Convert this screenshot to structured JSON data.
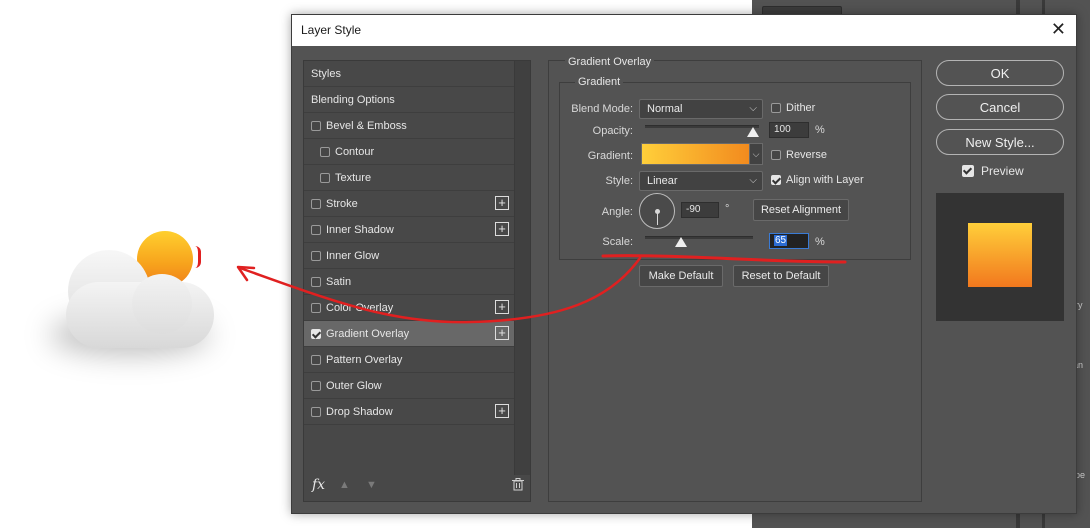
{
  "dialog": {
    "title": "Layer Style",
    "close_glyph": "✕"
  },
  "styles_list": {
    "items": [
      {
        "label": "Styles",
        "checkbox": false,
        "plus": false,
        "indent": false,
        "checked": false
      },
      {
        "label": "Blending Options",
        "checkbox": false,
        "plus": false,
        "indent": false,
        "checked": false
      },
      {
        "label": "Bevel & Emboss",
        "checkbox": true,
        "plus": false,
        "indent": false,
        "checked": false
      },
      {
        "label": "Contour",
        "checkbox": true,
        "plus": false,
        "indent": true,
        "checked": false
      },
      {
        "label": "Texture",
        "checkbox": true,
        "plus": false,
        "indent": true,
        "checked": false
      },
      {
        "label": "Stroke",
        "checkbox": true,
        "plus": true,
        "indent": false,
        "checked": false
      },
      {
        "label": "Inner Shadow",
        "checkbox": true,
        "plus": true,
        "indent": false,
        "checked": false
      },
      {
        "label": "Inner Glow",
        "checkbox": true,
        "plus": false,
        "indent": false,
        "checked": false
      },
      {
        "label": "Satin",
        "checkbox": true,
        "plus": false,
        "indent": false,
        "checked": false
      },
      {
        "label": "Color Overlay",
        "checkbox": true,
        "plus": true,
        "indent": false,
        "checked": false
      },
      {
        "label": "Gradient Overlay",
        "checkbox": true,
        "plus": true,
        "indent": false,
        "checked": true,
        "selected": true
      },
      {
        "label": "Pattern Overlay",
        "checkbox": true,
        "plus": false,
        "indent": false,
        "checked": false
      },
      {
        "label": "Outer Glow",
        "checkbox": true,
        "plus": false,
        "indent": false,
        "checked": false
      },
      {
        "label": "Drop Shadow",
        "checkbox": true,
        "plus": true,
        "indent": false,
        "checked": false
      }
    ],
    "footer": {
      "fx": "fx",
      "up": "▲",
      "down": "▼",
      "trash": "🗑"
    }
  },
  "gradient_overlay": {
    "group_title": "Gradient Overlay",
    "subgroup_title": "Gradient",
    "blend_mode": {
      "label": "Blend Mode:",
      "value": "Normal"
    },
    "dither": {
      "label": "Dither",
      "checked": false
    },
    "opacity": {
      "label": "Opacity:",
      "value": "100",
      "unit": "%",
      "fraction": 1.0
    },
    "gradient": {
      "label": "Gradient:",
      "colors": [
        "#ffcf3a",
        "#f28a1e"
      ]
    },
    "reverse": {
      "label": "Reverse",
      "checked": false
    },
    "style": {
      "label": "Style:",
      "value": "Linear"
    },
    "align_with_layer": {
      "label": "Align with Layer",
      "checked": true
    },
    "angle": {
      "label": "Angle:",
      "value": "-90",
      "unit": "°"
    },
    "reset_alignment": "Reset Alignment",
    "scale": {
      "label": "Scale:",
      "value": "65",
      "unit": "%",
      "fraction": 0.32
    },
    "make_default": "Make Default",
    "reset_to_default": "Reset to Default"
  },
  "actions": {
    "ok": "OK",
    "cancel": "Cancel",
    "new_style": "New Style...",
    "preview": {
      "label": "Preview",
      "checked": true
    },
    "preview_colors": [
      "#ffcf3a",
      "#f2781e"
    ]
  },
  "annotation": {
    "color": "#e02020"
  },
  "background_app": {
    "side_labels": [
      "ory",
      "ran",
      "ppe"
    ]
  }
}
